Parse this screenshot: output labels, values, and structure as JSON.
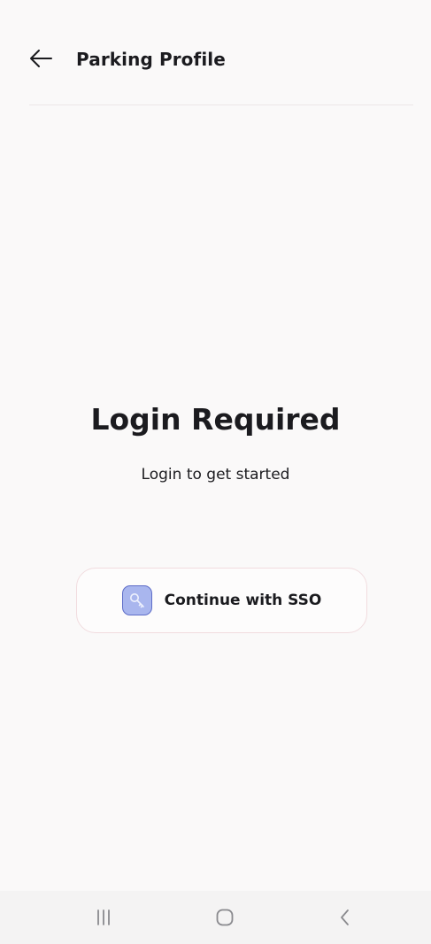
{
  "header": {
    "back_icon": "arrow-left-icon",
    "title": "Parking Profile"
  },
  "login": {
    "headline": "Login Required",
    "subline": "Login to get started",
    "sso_button": {
      "label": "Continue with SSO",
      "icon": "key-icon"
    }
  },
  "system_nav": {
    "recents_icon": "recents-icon",
    "home_icon": "home-icon",
    "back_icon": "nav-back-icon"
  },
  "colors": {
    "background": "#faf9f9",
    "text": "#1b1b1f",
    "divider": "#ece7e8",
    "button_border": "#f1dcdf",
    "sso_icon_fill": "#a9b6ee",
    "sso_icon_stroke": "#5e6dc8",
    "nav_bar": "#f4f3f3",
    "nav_icon": "#8a8a8e"
  }
}
